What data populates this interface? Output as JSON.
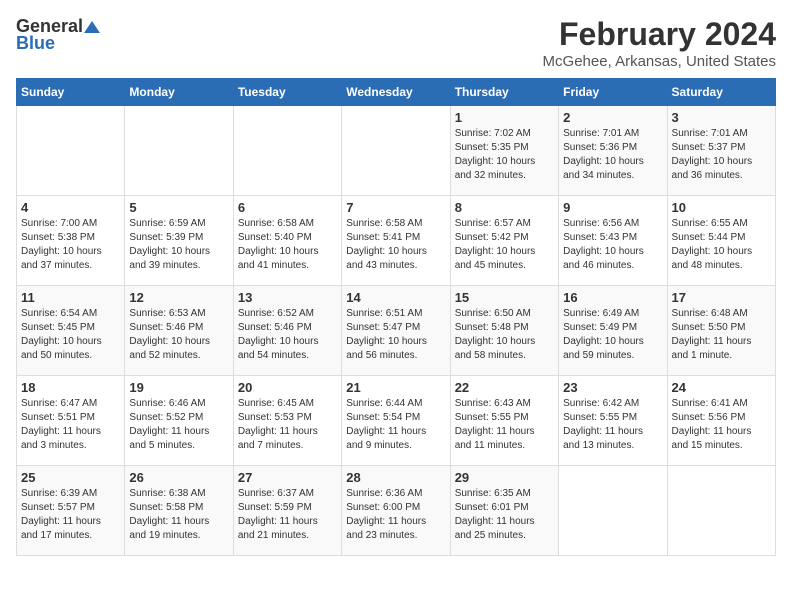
{
  "logo": {
    "general": "General",
    "blue": "Blue"
  },
  "title": "February 2024",
  "subtitle": "McGehee, Arkansas, United States",
  "days_of_week": [
    "Sunday",
    "Monday",
    "Tuesday",
    "Wednesday",
    "Thursday",
    "Friday",
    "Saturday"
  ],
  "weeks": [
    [
      {
        "day": "",
        "info": ""
      },
      {
        "day": "",
        "info": ""
      },
      {
        "day": "",
        "info": ""
      },
      {
        "day": "",
        "info": ""
      },
      {
        "day": "1",
        "info": "Sunrise: 7:02 AM\nSunset: 5:35 PM\nDaylight: 10 hours\nand 32 minutes."
      },
      {
        "day": "2",
        "info": "Sunrise: 7:01 AM\nSunset: 5:36 PM\nDaylight: 10 hours\nand 34 minutes."
      },
      {
        "day": "3",
        "info": "Sunrise: 7:01 AM\nSunset: 5:37 PM\nDaylight: 10 hours\nand 36 minutes."
      }
    ],
    [
      {
        "day": "4",
        "info": "Sunrise: 7:00 AM\nSunset: 5:38 PM\nDaylight: 10 hours\nand 37 minutes."
      },
      {
        "day": "5",
        "info": "Sunrise: 6:59 AM\nSunset: 5:39 PM\nDaylight: 10 hours\nand 39 minutes."
      },
      {
        "day": "6",
        "info": "Sunrise: 6:58 AM\nSunset: 5:40 PM\nDaylight: 10 hours\nand 41 minutes."
      },
      {
        "day": "7",
        "info": "Sunrise: 6:58 AM\nSunset: 5:41 PM\nDaylight: 10 hours\nand 43 minutes."
      },
      {
        "day": "8",
        "info": "Sunrise: 6:57 AM\nSunset: 5:42 PM\nDaylight: 10 hours\nand 45 minutes."
      },
      {
        "day": "9",
        "info": "Sunrise: 6:56 AM\nSunset: 5:43 PM\nDaylight: 10 hours\nand 46 minutes."
      },
      {
        "day": "10",
        "info": "Sunrise: 6:55 AM\nSunset: 5:44 PM\nDaylight: 10 hours\nand 48 minutes."
      }
    ],
    [
      {
        "day": "11",
        "info": "Sunrise: 6:54 AM\nSunset: 5:45 PM\nDaylight: 10 hours\nand 50 minutes."
      },
      {
        "day": "12",
        "info": "Sunrise: 6:53 AM\nSunset: 5:46 PM\nDaylight: 10 hours\nand 52 minutes."
      },
      {
        "day": "13",
        "info": "Sunrise: 6:52 AM\nSunset: 5:46 PM\nDaylight: 10 hours\nand 54 minutes."
      },
      {
        "day": "14",
        "info": "Sunrise: 6:51 AM\nSunset: 5:47 PM\nDaylight: 10 hours\nand 56 minutes."
      },
      {
        "day": "15",
        "info": "Sunrise: 6:50 AM\nSunset: 5:48 PM\nDaylight: 10 hours\nand 58 minutes."
      },
      {
        "day": "16",
        "info": "Sunrise: 6:49 AM\nSunset: 5:49 PM\nDaylight: 10 hours\nand 59 minutes."
      },
      {
        "day": "17",
        "info": "Sunrise: 6:48 AM\nSunset: 5:50 PM\nDaylight: 11 hours\nand 1 minute."
      }
    ],
    [
      {
        "day": "18",
        "info": "Sunrise: 6:47 AM\nSunset: 5:51 PM\nDaylight: 11 hours\nand 3 minutes."
      },
      {
        "day": "19",
        "info": "Sunrise: 6:46 AM\nSunset: 5:52 PM\nDaylight: 11 hours\nand 5 minutes."
      },
      {
        "day": "20",
        "info": "Sunrise: 6:45 AM\nSunset: 5:53 PM\nDaylight: 11 hours\nand 7 minutes."
      },
      {
        "day": "21",
        "info": "Sunrise: 6:44 AM\nSunset: 5:54 PM\nDaylight: 11 hours\nand 9 minutes."
      },
      {
        "day": "22",
        "info": "Sunrise: 6:43 AM\nSunset: 5:55 PM\nDaylight: 11 hours\nand 11 minutes."
      },
      {
        "day": "23",
        "info": "Sunrise: 6:42 AM\nSunset: 5:55 PM\nDaylight: 11 hours\nand 13 minutes."
      },
      {
        "day": "24",
        "info": "Sunrise: 6:41 AM\nSunset: 5:56 PM\nDaylight: 11 hours\nand 15 minutes."
      }
    ],
    [
      {
        "day": "25",
        "info": "Sunrise: 6:39 AM\nSunset: 5:57 PM\nDaylight: 11 hours\nand 17 minutes."
      },
      {
        "day": "26",
        "info": "Sunrise: 6:38 AM\nSunset: 5:58 PM\nDaylight: 11 hours\nand 19 minutes."
      },
      {
        "day": "27",
        "info": "Sunrise: 6:37 AM\nSunset: 5:59 PM\nDaylight: 11 hours\nand 21 minutes."
      },
      {
        "day": "28",
        "info": "Sunrise: 6:36 AM\nSunset: 6:00 PM\nDaylight: 11 hours\nand 23 minutes."
      },
      {
        "day": "29",
        "info": "Sunrise: 6:35 AM\nSunset: 6:01 PM\nDaylight: 11 hours\nand 25 minutes."
      },
      {
        "day": "",
        "info": ""
      },
      {
        "day": "",
        "info": ""
      }
    ]
  ]
}
